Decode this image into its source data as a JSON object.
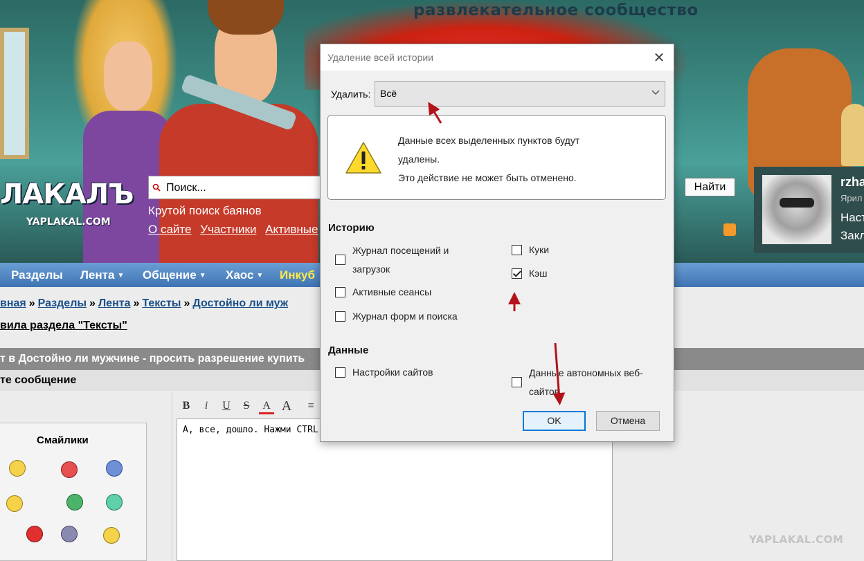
{
  "site": {
    "tagline": "развлекательное сообщество",
    "logo_text": "ЛАКАЛЪ",
    "domain": "YAPLAKAL.COM",
    "search_placeholder": "Поиск...",
    "search_hint": "Крутой поиск баянов",
    "header_links": [
      "О сайте",
      "Участники",
      "Активные"
    ],
    "find_button": "Найти",
    "user": {
      "name": "rzha",
      "meta": "Ярил",
      "link_settings": "Наст",
      "link_bookmarks": "Закл"
    },
    "nav": [
      "Разделы",
      "Лента",
      "Общение",
      "Хаос",
      "Инкуб"
    ],
    "breadcrumbs": [
      "вная",
      "Разделы",
      "Лента",
      "Тексты",
      "Достойно ли муж"
    ],
    "rules_link": "вила раздела \"Тексты\"",
    "topic_bar": "т в Достойно ли мужчине - просить разрешение купить",
    "reply_bar": "те сообщение",
    "smileys_title": "Смайлики",
    "toolbar": [
      "B",
      "i",
      "U",
      "S",
      "A",
      "A",
      "≡"
    ],
    "editor_text": "А, все, дошло. Нажми CTRL",
    "watermark": "YAPLAKAL.COM"
  },
  "dialog": {
    "title": "Удаление всей истории",
    "delete_label": "Удалить:",
    "delete_value": "Всё",
    "warning_line1": "Данные всех выделенных пунктов будут",
    "warning_line2": "удалены.",
    "warning_line3": "Это действие не может быть отменено.",
    "history_section": "Историю",
    "history_items": [
      {
        "label_line1": "Журнал посещений и",
        "label_line2": "загрузок",
        "checked": false
      },
      {
        "label": "Активные сеансы",
        "checked": false
      },
      {
        "label": "Журнал форм и поиска",
        "checked": false
      },
      {
        "label": "Куки",
        "checked": false
      },
      {
        "label": "Кэш",
        "checked": true
      }
    ],
    "data_section": "Данные",
    "data_items": [
      {
        "label": "Настройки сайтов",
        "checked": false
      },
      {
        "label_line1": "Данные автономных веб-",
        "label_line2": "сайтов",
        "checked": false
      }
    ],
    "ok_button": "OK",
    "cancel_button": "Отмена"
  },
  "colors": {
    "nav_bg": "#4a82c0",
    "annotation_red": "#b3121a",
    "ok_border": "#0078d7"
  }
}
